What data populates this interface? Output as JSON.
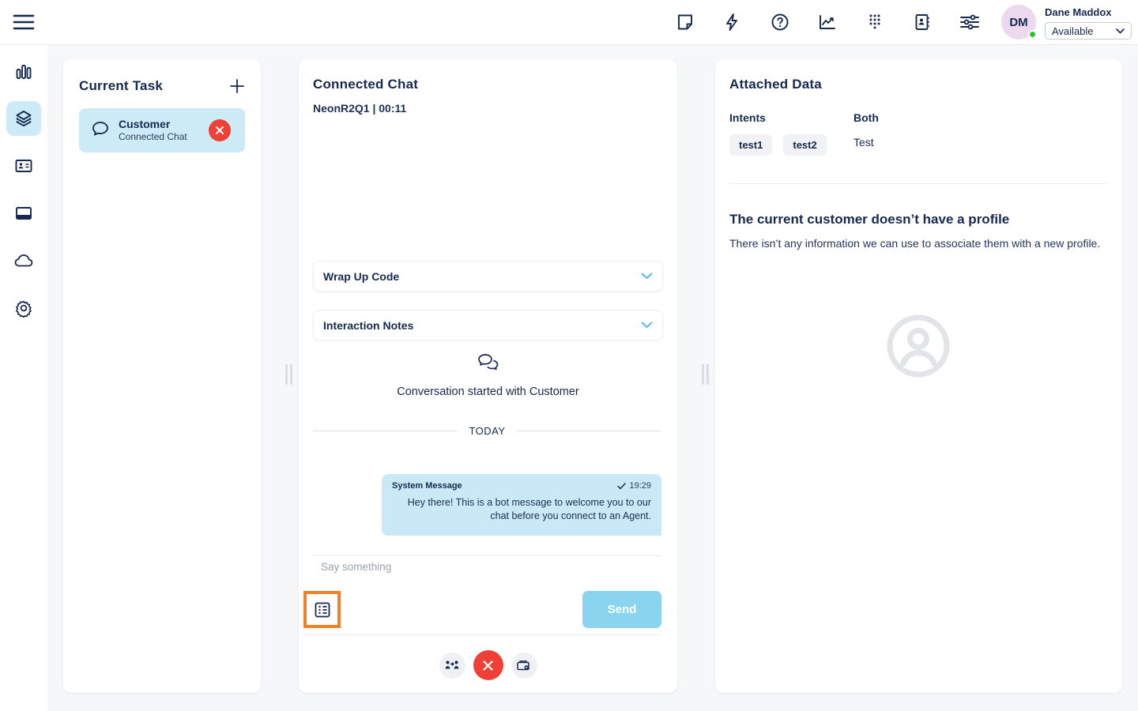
{
  "topbar": {
    "icons": [
      {
        "name": "notes-icon"
      },
      {
        "name": "quick-launch-icon"
      },
      {
        "name": "help-icon"
      },
      {
        "name": "performance-icon"
      },
      {
        "name": "dialpad-icon"
      },
      {
        "name": "address-book-icon"
      },
      {
        "name": "settings-sliders-icon"
      }
    ],
    "user": {
      "initials": "DM",
      "name": "Dane Maddox",
      "status": "Available"
    }
  },
  "current_task": {
    "title": "Current Task",
    "task": {
      "name": "Customer",
      "type": "Connected Chat"
    }
  },
  "chat": {
    "title": "Connected Chat",
    "subtitle": "NeonR2Q1 | 00:11",
    "wrap_up_label": "Wrap Up Code",
    "notes_label": "Interaction Notes",
    "conversation_started": "Conversation started with Customer",
    "day_divider": "TODAY",
    "message": {
      "sender": "System Message",
      "time": "19:29",
      "text": "Hey there! This is a bot message to welcome you to our chat before you connect to an Agent."
    },
    "input_placeholder": "Say something",
    "send_label": "Send"
  },
  "attached_data": {
    "title": "Attached Data",
    "intents_label": "Intents",
    "intents": [
      "test1",
      "test2"
    ],
    "both_label": "Both",
    "both_value": "Test",
    "no_profile_title": "The current customer doesn’t have a profile",
    "no_profile_body": "There isn’t any information we can use to associate them with a new profile."
  },
  "colors": {
    "navy": "#16294e",
    "accent_light_blue": "#cdeaf7",
    "bubble_blue": "#c9e9f6",
    "send_blue": "#8bd4f0",
    "chevron_blue": "#4fb9e2",
    "danger_red": "#ee4036",
    "highlight_orange": "#f08126",
    "status_green": "#2dc52d",
    "avatar_pink": "#ecd9ed"
  }
}
